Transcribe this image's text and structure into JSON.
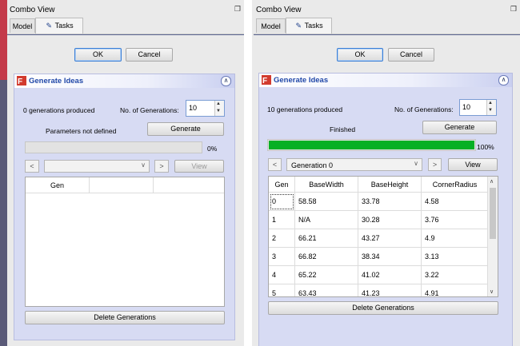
{
  "left": {
    "window_title": "Combo View",
    "tabs": [
      {
        "label": "Model"
      },
      {
        "label": "Tasks"
      }
    ],
    "ok_label": "OK",
    "cancel_label": "Cancel",
    "panel_title": "Generate Ideas",
    "generations_produced": "0 generations produced",
    "num_generations_label": "No. of Generations:",
    "num_generations_value": "10",
    "status": "Parameters not defined",
    "generate_label": "Generate",
    "progress": 0,
    "progress_text": "0%",
    "nav_prev": "<",
    "nav_next": ">",
    "view_label": "View",
    "table_headers": [
      "Gen"
    ],
    "delete_label": "Delete Generations"
  },
  "right": {
    "window_title": "Combo View",
    "tabs": [
      {
        "label": "Model"
      },
      {
        "label": "Tasks"
      }
    ],
    "ok_label": "OK",
    "cancel_label": "Cancel",
    "panel_title": "Generate Ideas",
    "generations_produced": "10 generations produced",
    "num_generations_label": "No. of Generations:",
    "num_generations_value": "10",
    "status": "Finished",
    "generate_label": "Generate",
    "progress": 1.0,
    "progress_text": "100%",
    "nav_prev": "<",
    "nav_next": ">",
    "generation_select": "Generation 0",
    "view_label": "View",
    "table_headers": [
      "Gen",
      "BaseWidth",
      "BaseHeight",
      "CornerRadius"
    ],
    "rows": [
      {
        "gen": "0",
        "base_width": "58.58",
        "base_height": "33.78",
        "corner_radius": "4.58"
      },
      {
        "gen": "1",
        "base_width": "N/A",
        "base_height": "30.28",
        "corner_radius": "3.76"
      },
      {
        "gen": "2",
        "base_width": "66.21",
        "base_height": "43.27",
        "corner_radius": "4.9"
      },
      {
        "gen": "3",
        "base_width": "66.82",
        "base_height": "38.34",
        "corner_radius": "3.13"
      },
      {
        "gen": "4",
        "base_width": "65.22",
        "base_height": "41.02",
        "corner_radius": "3.22"
      },
      {
        "gen": "5",
        "base_width": "63.43",
        "base_height": "41.23",
        "corner_radius": "4.91"
      }
    ],
    "delete_label": "Delete Generations"
  },
  "icons": {
    "dock": "dock-icon",
    "pen": "pencil-icon",
    "collapse": "collapse-icon",
    "app": "freecad-icon"
  }
}
